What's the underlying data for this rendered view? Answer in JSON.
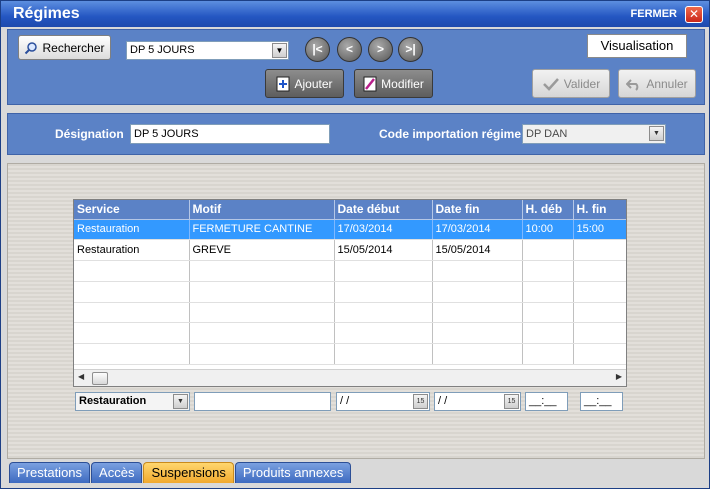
{
  "window": {
    "title": "Régimes",
    "close_label": "FERMER",
    "close_glyph": "✕"
  },
  "toolbar": {
    "search_label": "Rechercher",
    "regime_value": "DP 5 JOURS",
    "nav": {
      "first": "|<",
      "prev": "<",
      "next": ">",
      "last": ">|"
    },
    "visualisation_label": "Visualisation",
    "add_label": "Ajouter",
    "modify_label": "Modifier",
    "validate_label": "Valider",
    "cancel_label": "Annuler"
  },
  "designation": {
    "label": "Désignation",
    "value": "DP 5 JOURS",
    "code_label": "Code importation régime",
    "code_value": "DP DAN"
  },
  "grid": {
    "columns": [
      "Service",
      "Motif",
      "Date début",
      "Date fin",
      "H. déb",
      "H. fin"
    ],
    "rows": [
      [
        "Restauration",
        "FERMETURE CANTINE",
        "17/03/2014",
        "17/03/2014",
        "10:00",
        "15:00"
      ],
      [
        "Restauration",
        "GREVE",
        "15/05/2014",
        "15/05/2014",
        "",
        ""
      ],
      [
        "",
        "",
        "",
        "",
        "",
        ""
      ],
      [
        "",
        "",
        "",
        "",
        "",
        ""
      ],
      [
        "",
        "",
        "",
        "",
        "",
        ""
      ],
      [
        "",
        "",
        "",
        "",
        "",
        ""
      ],
      [
        "",
        "",
        "",
        "",
        "",
        ""
      ],
      [
        "",
        "",
        "",
        "",
        "",
        ""
      ]
    ],
    "selected_row": 0
  },
  "editor": {
    "service_value": "Restauration",
    "motif_value": "",
    "date_debut_value": " / /",
    "date_fin_value": " / /",
    "calendar_glyph": "15",
    "h_deb_value": "__:__",
    "h_fin_value": "__:__"
  },
  "tabs": [
    {
      "label": "Prestations",
      "active": false
    },
    {
      "label": "Accès",
      "active": false
    },
    {
      "label": "Suspensions",
      "active": true
    },
    {
      "label": "Produits annexes",
      "active": false
    }
  ],
  "colors": {
    "panel": "#5b82c6",
    "title_bar": "#2456c2",
    "selection": "#3399ff",
    "active_tab": "#f1a92e"
  }
}
